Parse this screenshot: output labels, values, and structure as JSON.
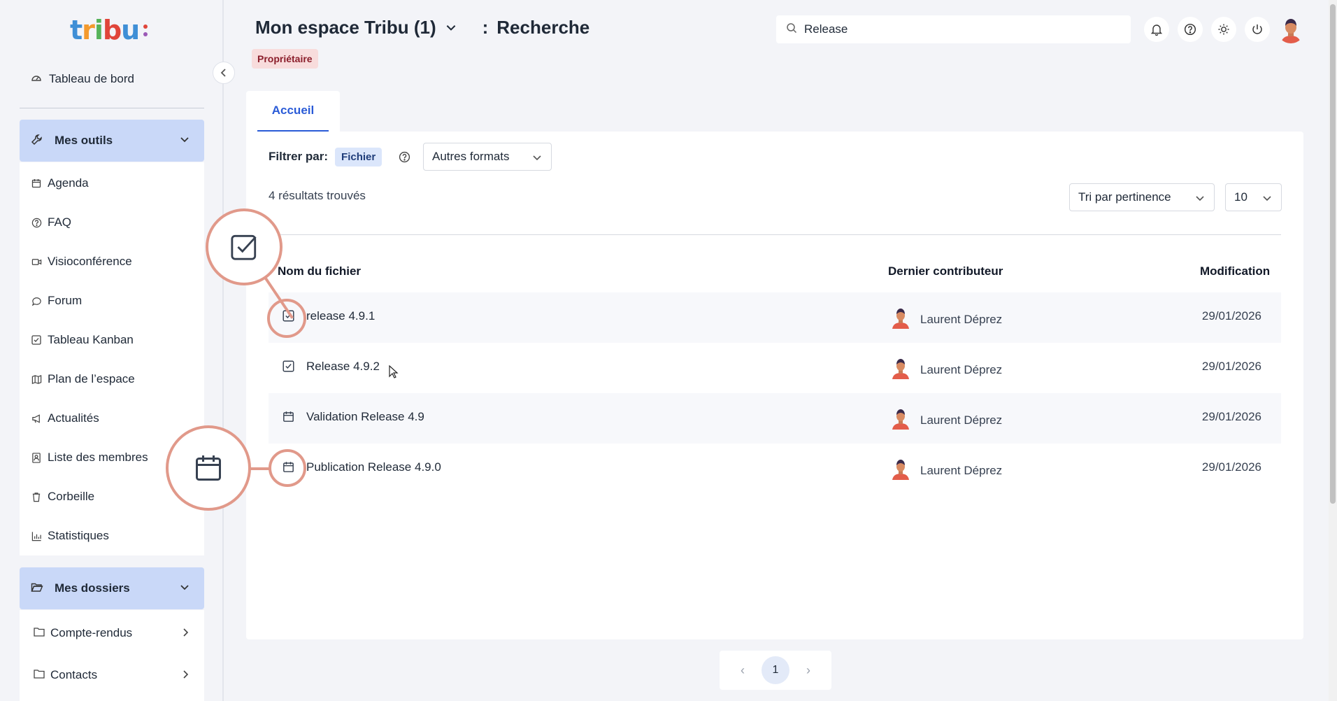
{
  "brand": {
    "logo_letters": [
      "t",
      "r",
      "i",
      "b",
      "u"
    ],
    "logo_colors": [
      "#3f8fd6",
      "#f39a2e",
      "#56b35a",
      "#e0453a",
      "#3f8fd6"
    ],
    "accent": "#2a5bd7"
  },
  "sidebar": {
    "dashboard": "Tableau de bord",
    "tools_section": "Mes outils",
    "tools": [
      {
        "label": "Agenda",
        "icon": "calendar-icon"
      },
      {
        "label": "FAQ",
        "icon": "question-icon"
      },
      {
        "label": "Visioconférence",
        "icon": "video-icon"
      },
      {
        "label": "Forum",
        "icon": "chat-icon"
      },
      {
        "label": "Tableau Kanban",
        "icon": "checkbox-icon"
      },
      {
        "label": "Plan de l’espace",
        "icon": "map-icon"
      },
      {
        "label": "Actualités",
        "icon": "megaphone-icon"
      },
      {
        "label": "Liste des membres",
        "icon": "contacts-icon"
      },
      {
        "label": "Corbeille",
        "icon": "trash-icon"
      },
      {
        "label": "Statistiques",
        "icon": "stats-icon"
      }
    ],
    "folders_section": "Mes dossiers",
    "folders": [
      {
        "label": "Compte-rendus",
        "icon": "folder-icon"
      },
      {
        "label": "Contacts",
        "icon": "folder-icon"
      }
    ]
  },
  "header": {
    "space_name": "Mon espace Tribu (1)",
    "separator": ":",
    "page_name": "Recherche",
    "role_badge": "Propriétaire",
    "search_value": "Release"
  },
  "tabs": [
    {
      "label": "Accueil",
      "active": true
    }
  ],
  "filters": {
    "label": "Filtrer par:",
    "chip": "Fichier",
    "format_select": "Autres formats",
    "sort_select": "Tri par pertinence",
    "page_size_select": "10"
  },
  "results_count": "4 résultats trouvés",
  "table": {
    "headers": {
      "name": "Nom du fichier",
      "contributor": "Dernier contributeur",
      "modified": "Modification"
    },
    "rows": [
      {
        "name": "release 4.9.1",
        "icon": "checkbox-icon",
        "contributor": "Laurent Déprez",
        "date": "29/01/2026"
      },
      {
        "name": "Release 4.9.2",
        "icon": "checkbox-icon",
        "contributor": "Laurent Déprez",
        "date": "29/01/2026"
      },
      {
        "name": "Validation Release 4.9",
        "icon": "calendar-icon",
        "contributor": "Laurent Déprez",
        "date": "29/01/2026"
      },
      {
        "name": "Publication Release 4.9.0",
        "icon": "calendar-icon",
        "contributor": "Laurent Déprez",
        "date": "29/01/2026"
      }
    ]
  },
  "pagination": {
    "current": "1",
    "prev": "‹",
    "next": "›"
  }
}
